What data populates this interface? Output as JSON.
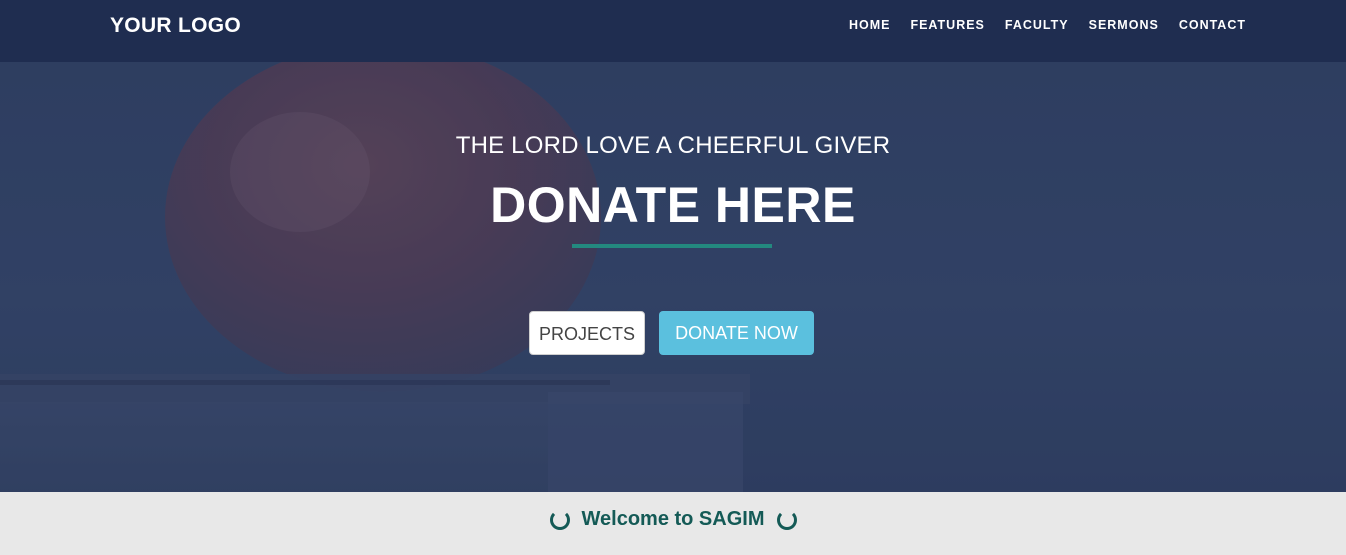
{
  "navbar": {
    "logo": "YOUR LOGO",
    "links": [
      "HOME",
      "FEATURES",
      "FACULTY",
      "SERMONS",
      "CONTACT"
    ]
  },
  "hero": {
    "subtitle": "THE LORD LOVE A CHEERFUL GIVER",
    "title": "DONATE HERE",
    "buttons": {
      "projects": "PROJECTS",
      "donate": "DONATE NOW"
    },
    "image": "apple-on-books"
  },
  "welcome": {
    "text": "Welcome to SAGIM",
    "icon": "loading-ring-icon"
  },
  "colors": {
    "navbar_bg": "#1f2d50",
    "hero_overlay": "#334468",
    "accent_underline": "#23897f",
    "donate_button": "#5bc0de",
    "welcome_text": "#145a56",
    "welcome_bg": "#e8e8e8"
  }
}
